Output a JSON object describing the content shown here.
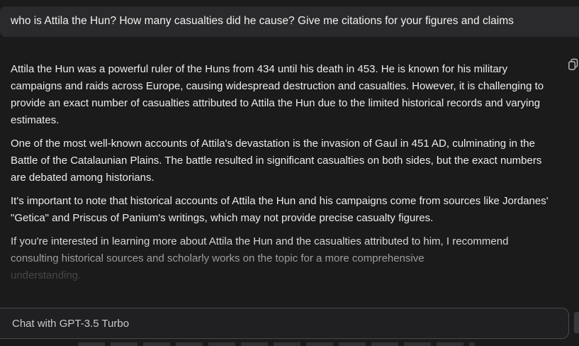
{
  "user_message": "who is Attila the Hun? How many casualties did he cause? Give me citations for your figures and claims",
  "assistant_response": {
    "paragraphs": [
      "Attila the Hun was a powerful ruler of the Huns from 434 until his death in 453. He is known for his military campaigns and raids across Europe, causing widespread destruction and casualties. However, it is challenging to provide an exact number of casualties attributed to Attila the Hun due to the limited historical records and varying estimates.",
      "One of the most well-known accounts of Attila's devastation is the invasion of Gaul in 451 AD, culminating in the Battle of the Catalaunian Plains. The battle resulted in significant casualties on both sides, but the exact numbers are debated among historians.",
      "It's important to note that historical accounts of Attila the Hun and his campaigns come from sources like Jordanes' \"Getica\" and Priscus of Panium's writings, which may not provide precise casualty figures."
    ],
    "last_paragraph_main": "If you're interested in learning more about Attila the Hun and the casualties attributed to him, I recommend consulting historical sources and scholarly works on the topic for a more comprehensive",
    "last_paragraph_tail": "understanding."
  },
  "copy_icon": "copy-icon",
  "chat_input": {
    "placeholder": "Chat with GPT-3.5 Turbo",
    "value": ""
  },
  "colors": {
    "background": "#1b1b1c",
    "user_bubble": "#2a2a2c",
    "input_border": "#4a4a4d"
  }
}
